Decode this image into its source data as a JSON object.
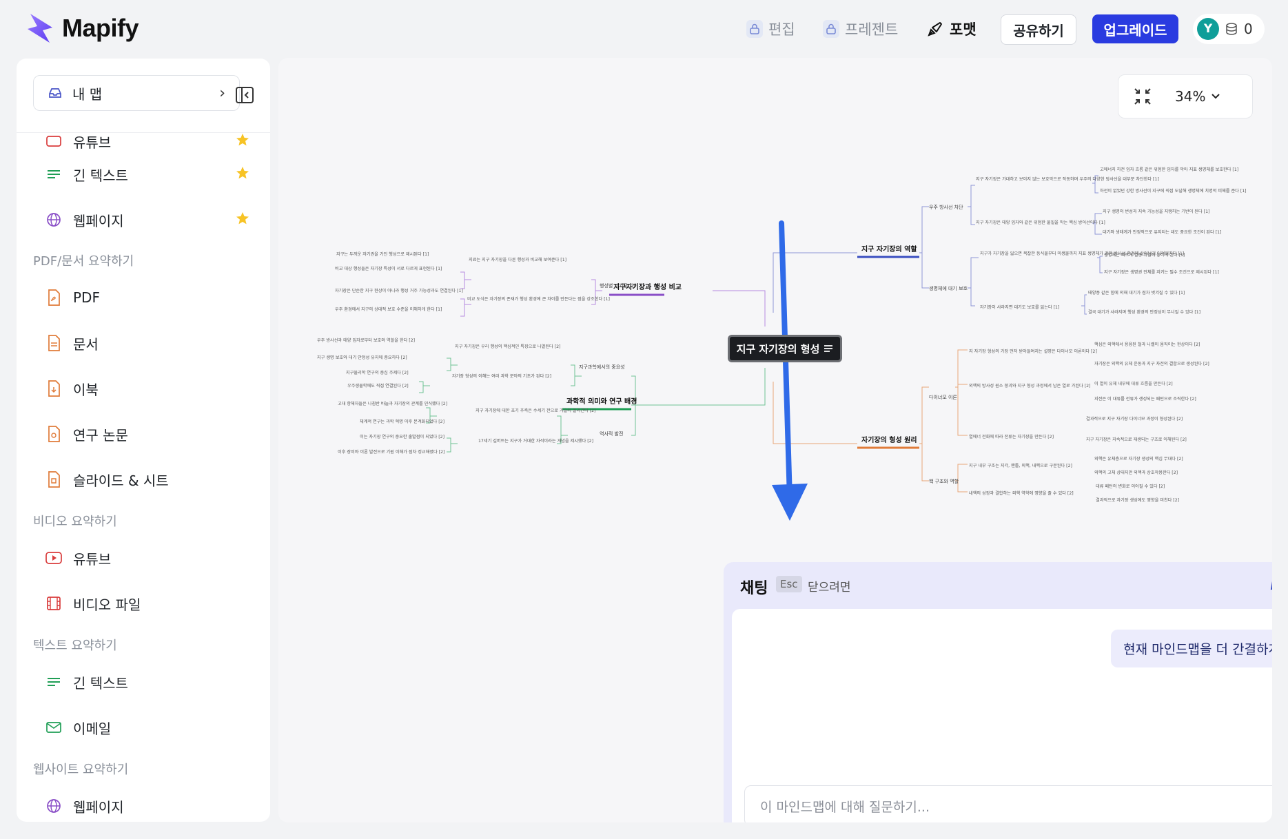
{
  "app": {
    "name": "Mapify"
  },
  "header": {
    "edit_label": "편집",
    "present_label": "프레젠트",
    "format_label": "포맷",
    "share_label": "공유하기",
    "upgrade_label": "업그레이드",
    "avatar_initial": "Y",
    "credits": "0"
  },
  "sidebar": {
    "my_map_label": "내 맵",
    "top_partial": "유튜브",
    "items_top": [
      {
        "label": "긴 텍스트",
        "icon": "lines-icon",
        "starred": true
      },
      {
        "label": "웹페이지",
        "icon": "globe-icon",
        "starred": true
      }
    ],
    "section_pdf": "PDF/문서 요약하기",
    "pdf_items": [
      "PDF",
      "문서",
      "이북",
      "연구 논문",
      "슬라이드 & 시트"
    ],
    "section_video": "비디오 요약하기",
    "video_items": [
      "유튜브",
      "비디오 파일"
    ],
    "section_text": "텍스트 요약하기",
    "text_items": [
      "긴 텍스트",
      "이메일"
    ],
    "section_web": "웹사이트 요약하기",
    "web_items": [
      "웹페이지"
    ]
  },
  "canvas": {
    "zoom": "34%",
    "center_node": "지구 자기장의 형성",
    "branches": {
      "b1": "지구 자기장의 역할",
      "b1_sub": [
        "우주 방사선 차단",
        "생명체에 대기 보호"
      ],
      "b2": "자기장의 형성 원리",
      "b2_sub": [
        "다이너모 이론",
        "핵 구조와 역할"
      ],
      "b3": "지구자기장과 행성 비교",
      "b3_sub": [
        "행성별 자기장 차이"
      ],
      "b4": "과학적 의미와 연구 배경",
      "b4_sub": [
        "지구과학에서의 중요성",
        "역사적 발전"
      ]
    },
    "leaves": {
      "r1": [
        "지구 자기장은 가대하고 보이지 않는 보호막으로 작동하며 우주의 다양한 방사선을 대부분 차단한다 [1]",
        "지구 자기장은 태양 입자와 같은 위험한 물질을 막는 핵심 방어선이다 [1]",
        "지구가 자기장을 잃으면 복잡한 동식물부터 미생물까지 지표 생명체가 강한 방사선 환경에 살아남기 어려워진다 [1]",
        "자기장이 사라지면 대기도 보호를 잃는다 [1]"
      ],
      "r1b": [
        "고에너지 하전 입자 흐름 같은 위험한 입자를 막아 지표 생명체를 보호한다 [1]",
        "하전이 없었던 강한 방사선이 지구에 직접 도달해 생명체에 치명적 피해를 준다 [1]",
        "지구 생명의 번성과 지속 가능성을 지탱하는 기반이 된다 [1]",
        "대기와 생태계가 안정적으로 유지되는 데도 중요한 조건이 된다 [1]",
        "생명체는 빠르게 멸종 위험에 놓이게 된다 [1]",
        "지구 자기장은 생명권 전체를 지키는 필수 조건으로 제시된다 [1]",
        "태양풍 같은 힘에 의해 대기가 점차 벗겨질 수 있다 [1]",
        "결국 대기가 사라지며 행성 환경의 안정성이 무너질 수 있다 [1]"
      ],
      "r2": [
        "지 자기장 형성의 가장 먼저 받아들여지는 설명은 다이너모 이론이다 [2]",
        "외핵의 방사성 원소 붕괴와 지구 형성 과정에서 남은 열로 가된다 [2]",
        "열에너 전화에 따라 전류는 자기장을 만든다 [2]",
        "지구 내부 구조는 지각, 맨틀, 외핵, 내핵으로 구분된다 [2]",
        "내핵의 성장과 결합하는 외핵 역학에 영향을 줄 수 있다 [2]"
      ],
      "r2b": [
        "핵심은 외핵에서 용융된 철과 니켈이 움직이는 현상이다 [2]",
        "자기장은 외핵의 유체 운동과 지구 자전의 결합으로 생성된다 [2]",
        "이 열이 유체 내부에 대류 흐름을 만든다 [2]",
        "지전은 이 대류를 전류가 생성되는 패턴으로 조직한다 [2]",
        "결과적으로 지구 자기장 다이너모 과정이 형성된다 [2]",
        "지구 자기장은 지속적으로 재생되는 구조로 이해된다 [2]",
        "외핵은 유체층으로 자기장 생성의 핵심 무대다 [2]",
        "외핵의 고체 상태지만 외핵과 상호작용한다 [2]",
        "대류 패턴의 변화로 이어질 수 있다 [2]",
        "결과적으로 자기장 생성에도 영향을 미친다 [2]"
      ],
      "l1": [
        "지구는 두꺼운 자기권을 가진 행성으로 제시된다 [1]",
        "비교 대상 행성들은 자기장 특성이 서로 다르게 표현된다 [1]",
        "자기장은 단순한 지구 현상이 아니라 행성 거주 가능성과도 연결된다 [1]",
        "우주 환경에서 지구의 상대적 보호 수준을 이해하게 한다 [1]"
      ],
      "l1b": [
        "지료는 지구 자기장을 다른 행성과 비교해 보여준다 [1]",
        "비교 도식은 자기장의 존재가 행성 환경에 큰 차이를 만든다는 점을 강조한다 [1]"
      ],
      "l2": [
        "우주 방사선과 태양 입자로부터 보호와 역할을 한다 [2]",
        "지구 생명 보호와 대기 안정성 유지에 중요하다 [2]",
        "지구물리학 연구의 중심 주제다 [2]",
        "우주생물학에도 직접 연결된다 [2]",
        "고대 항해자들은 나침반 바늘과 자기장의 관계를 인식했다 [2]",
        "체계적 연구는 과학 혁명 이후 본격화되었다 [2]",
        "이는 자기장 연구의 중요한 출발점이 되었다 [2]",
        "이후 장비와 이론 발전으로 기원 이해가 점차 정교해졌다 [2]"
      ],
      "l2b": [
        "지구 자기장은 우리 행성의 핵심적인 특징으로 나열된다 [2]",
        "자기장 형성의 이해는 여러 과학 분야의 기초가 된다 [2]",
        "지구 자기장에 대한 초기 추측은 수세기 전으로 거슬러 올라간다 [2]",
        "17세기 길버트는 지구가 거대한 자석이라는 개념을 제시했다 [2]"
      ]
    }
  },
  "chat": {
    "title": "채팅",
    "esc_key": "Esc",
    "esc_hint": "닫으려면",
    "user_message": "현재 마인드맵을 더 간결하게 만드세요.",
    "input_placeholder": "이 마인드맵에 대해 질문하기..."
  },
  "colors": {
    "accent": "#2a3be0",
    "branch_blue": "#3a4ec0",
    "branch_orange": "#e07b39",
    "branch_purple": "#8a4fc7",
    "branch_green": "#1f9e55",
    "arrow": "#2f6ae8"
  }
}
